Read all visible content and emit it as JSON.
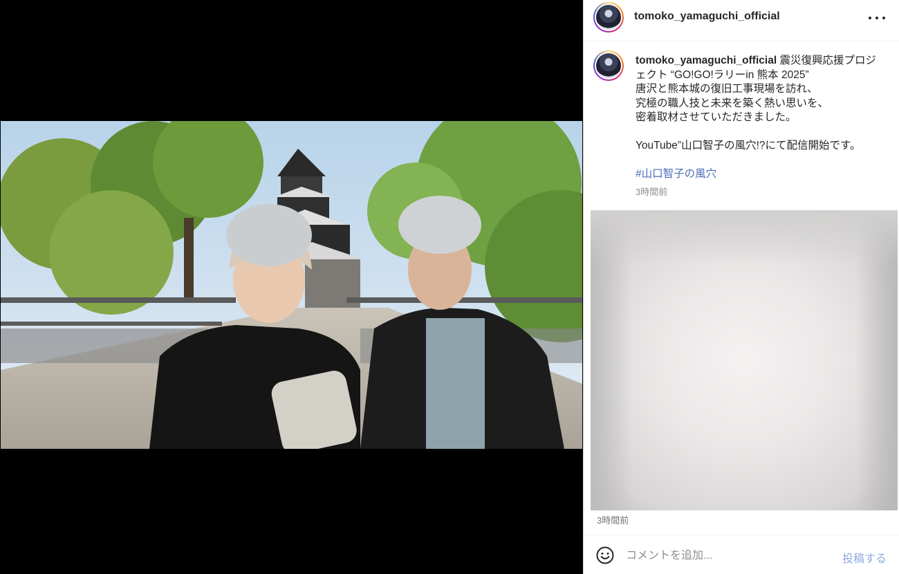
{
  "post": {
    "username": "tomoko_yamaguchi_official",
    "more_icon": "more-options-icon"
  },
  "caption": {
    "username": "tomoko_yamaguchi_official",
    "lines": [
      " 震災復興応援プロジェクト “GO!GO!ラリーin 熊本 2025”",
      "唐沢と熊本城の復旧工事現場を訪れ、",
      "究極の職人技と未来を築く熱い思いを、",
      "密着取材させていただきました。",
      "YouTube”山口智子の風穴!?にて配信開始です。"
    ],
    "hashtag": "#山口智子の風穴",
    "time": "3時間前"
  },
  "comment_section": {
    "time": "3時間前",
    "emoji_icon": "emoji-icon",
    "input_placeholder": "コメントを追加...",
    "post_label": "投稿する"
  },
  "colors": {
    "link": "#4a6ab8",
    "post_button": "#8fa9e0",
    "text": "#262626",
    "muted": "#8e8e8e"
  }
}
